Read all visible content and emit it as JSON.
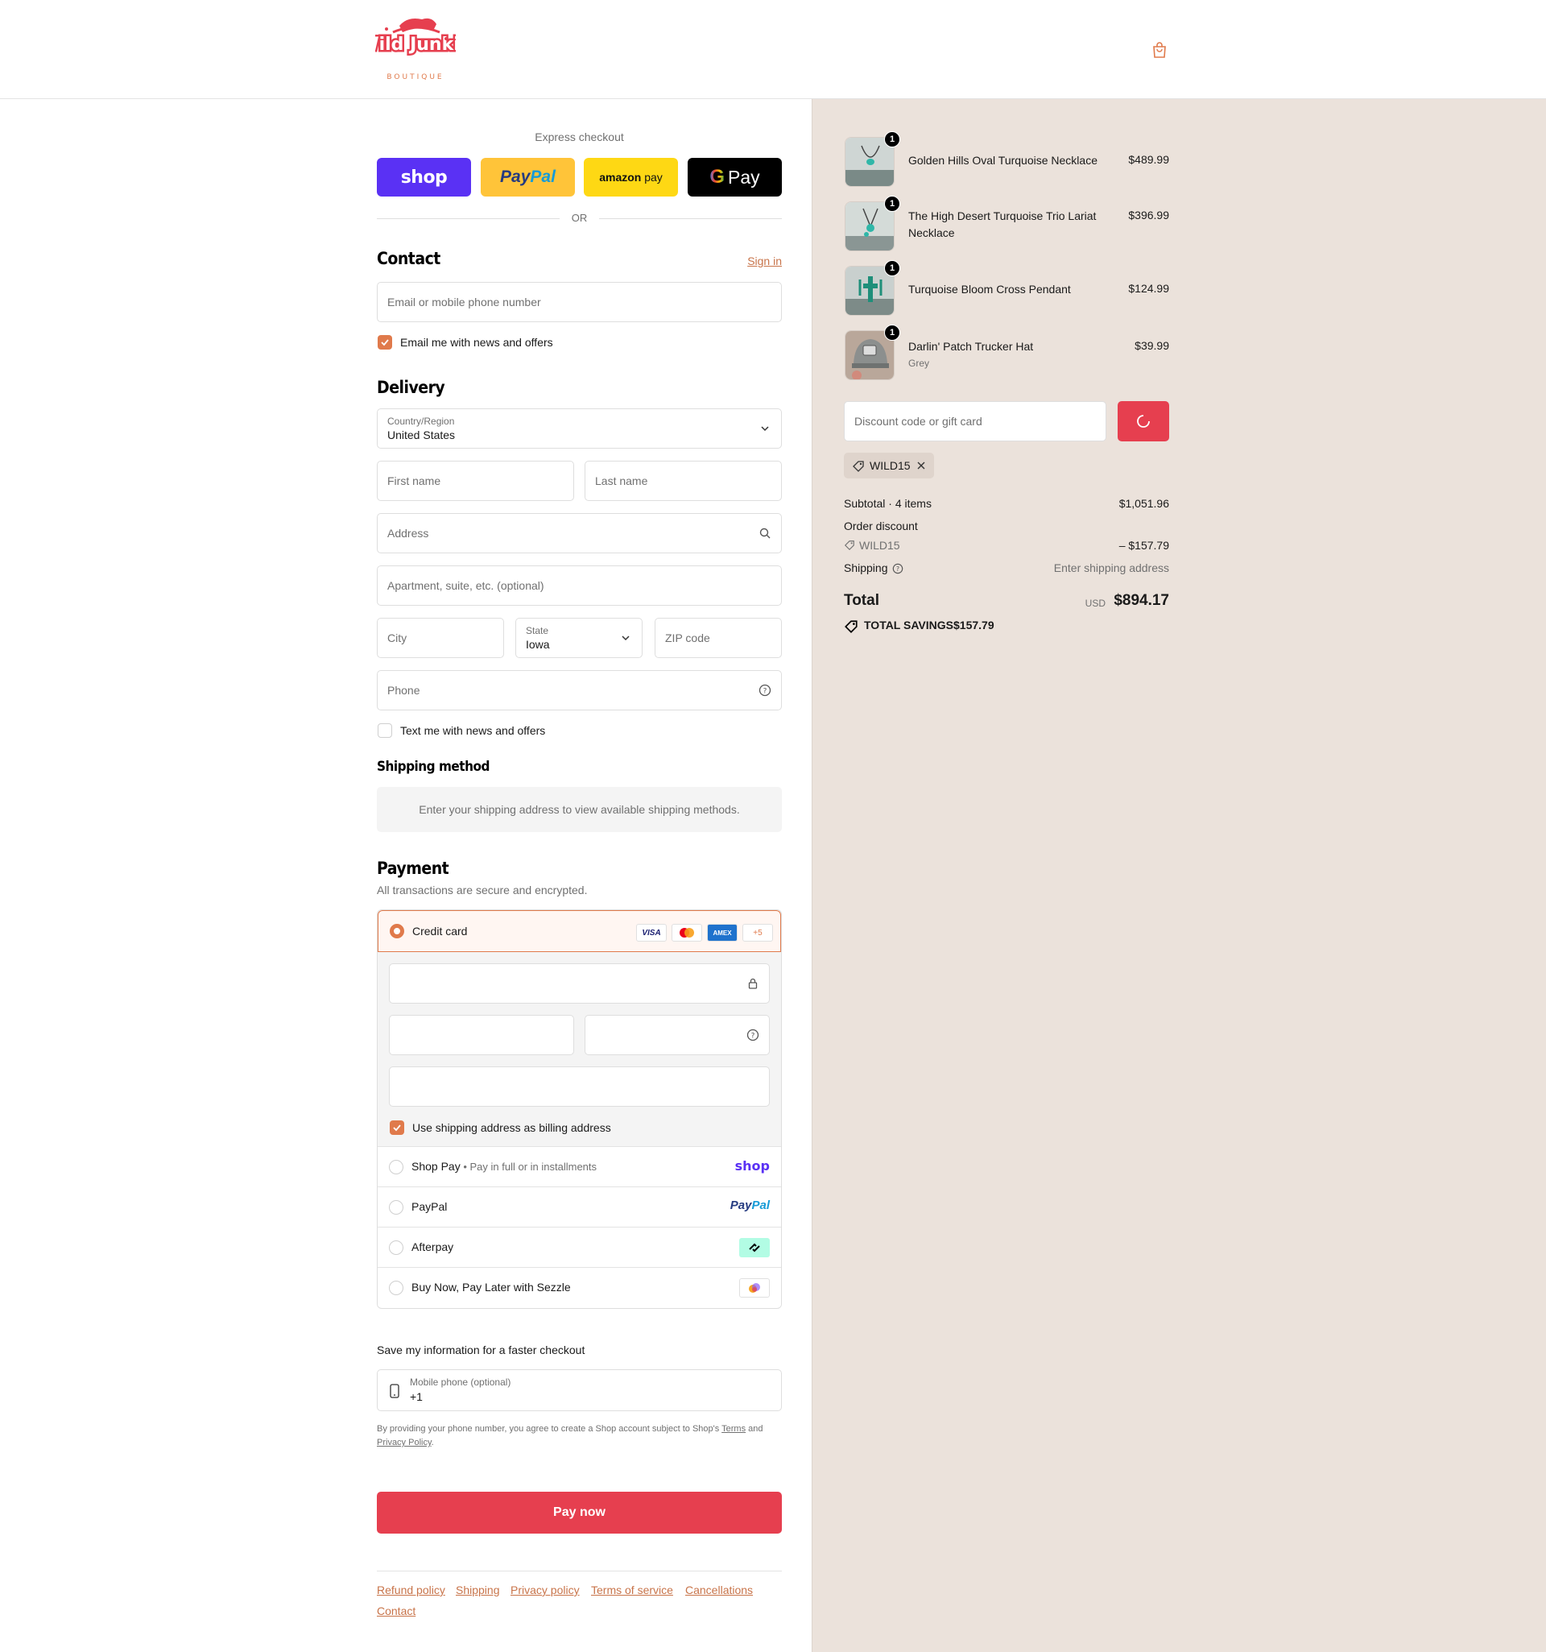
{
  "header": {
    "logo_text": "Wild Junkie",
    "logo_sub": "BOUTIQUE",
    "brand_color": "#e63f4f",
    "accent_color": "#e07a4b"
  },
  "express": {
    "title": "Express checkout",
    "shop": "shop",
    "paypal_pay": "Pay",
    "paypal_pal": "Pal",
    "amazon": "amazon",
    "amazon_pay": "pay",
    "gpay": "Pay",
    "or": "OR"
  },
  "contact": {
    "title": "Contact",
    "sign_in": "Sign in",
    "email_placeholder": "Email or mobile phone number",
    "email_opt_in": "Email me with news and offers"
  },
  "delivery": {
    "title": "Delivery",
    "country_label": "Country/Region",
    "country_value": "United States",
    "first_name": "First name",
    "last_name": "Last name",
    "address": "Address",
    "apartment": "Apartment, suite, etc. (optional)",
    "city": "City",
    "state_label": "State",
    "state_value": "Iowa",
    "zip": "ZIP code",
    "phone": "Phone",
    "text_opt_in": "Text me with news and offers"
  },
  "shipping_method": {
    "title": "Shipping method",
    "message": "Enter your shipping address to view available shipping methods."
  },
  "payment": {
    "title": "Payment",
    "subtitle": "All transactions are secure and encrypted.",
    "credit_card": "Credit card",
    "card_logos": [
      "VISA",
      "AMEX",
      "+5"
    ],
    "billing_same": "Use shipping address as billing address",
    "shop_pay": "Shop Pay",
    "shop_pay_sub": "Pay in full or in installments",
    "shop_pay_logo": "shop",
    "paypal": "PayPal",
    "paypal_logo_pay": "Pay",
    "paypal_logo_pal": "Pal",
    "afterpay": "Afterpay",
    "sezzle": "Buy Now, Pay Later with Sezzle"
  },
  "save_info": {
    "title": "Save my information for a faster checkout",
    "phone_label": "Mobile phone (optional)",
    "phone_value": "+1",
    "legal_1": "By providing your phone number, you agree to create a Shop account subject to Shop's",
    "terms": "Terms",
    "legal_and": "and",
    "privacy": "Privacy Policy",
    "legal_end": "."
  },
  "pay_now": "Pay now",
  "footer": {
    "links": [
      "Refund policy",
      "Shipping",
      "Privacy policy",
      "Terms of service",
      "Cancellations",
      "Contact"
    ]
  },
  "cart": {
    "items": [
      {
        "name": "Golden Hills Oval Turquoise Necklace",
        "price": "$489.99",
        "qty": "1"
      },
      {
        "name": "The High Desert Turquoise Trio Lariat Necklace",
        "price": "$396.99",
        "qty": "1"
      },
      {
        "name": "Turquoise Bloom Cross Pendant",
        "price": "$124.99",
        "qty": "1"
      },
      {
        "name": "Darlin' Patch Trucker Hat",
        "variant": "Grey",
        "price": "$39.99",
        "qty": "1"
      }
    ],
    "discount_placeholder": "Discount code or gift card",
    "applied_code": "WILD15",
    "subtotal_label": "Subtotal · 4 items",
    "subtotal_value": "$1,051.96",
    "order_discount": "Order discount",
    "discount_code": "WILD15",
    "discount_value": "– $157.79",
    "shipping_label": "Shipping",
    "shipping_value": "Enter shipping address",
    "total_label": "Total",
    "currency": "USD",
    "total_value": "$894.17",
    "savings_label": "TOTAL SAVINGS",
    "savings_value": "$157.79"
  }
}
